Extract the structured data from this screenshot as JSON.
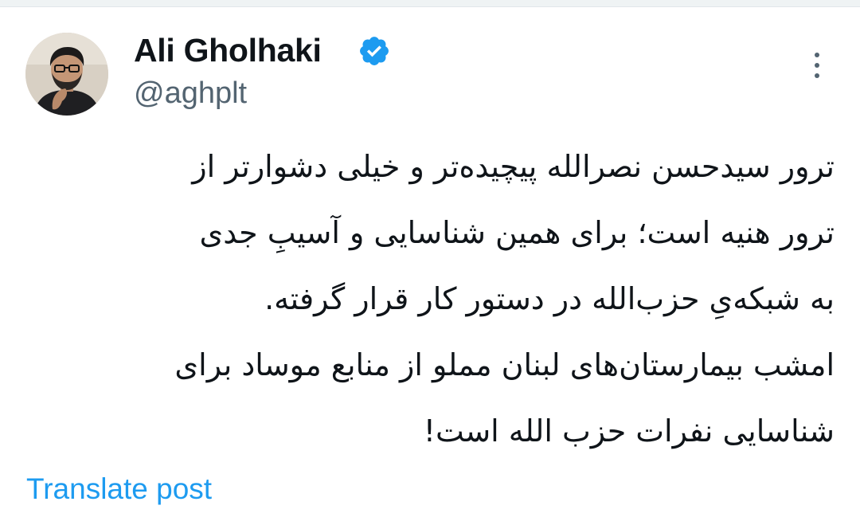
{
  "author": {
    "display_name": "Ali Gholhaki",
    "handle": "@aghplt",
    "verified": true,
    "avatar_icon": "user-avatar-photo",
    "badge_color": "#1d9bf0"
  },
  "post": {
    "lines": [
      "ترور سیدحسن نصرالله پیچیده‌تر و خیلی دشوارتر از",
      "ترور هنیه است؛ برای همین شناسایی و آسیبِ جدی",
      "به شبکه‌یِ حزب‌الله در دستور کار قرار گرفته.",
      "امشب بیمارستان‌های لبنان مملو از منابع موساد برای",
      "شناسایی نفرات حزب الله است!"
    ]
  },
  "actions": {
    "translate_label": "Translate post",
    "more_icon": "more-vertical-icon"
  },
  "colors": {
    "text": "#0f1419",
    "secondary": "#536471",
    "link": "#1d9bf0"
  }
}
